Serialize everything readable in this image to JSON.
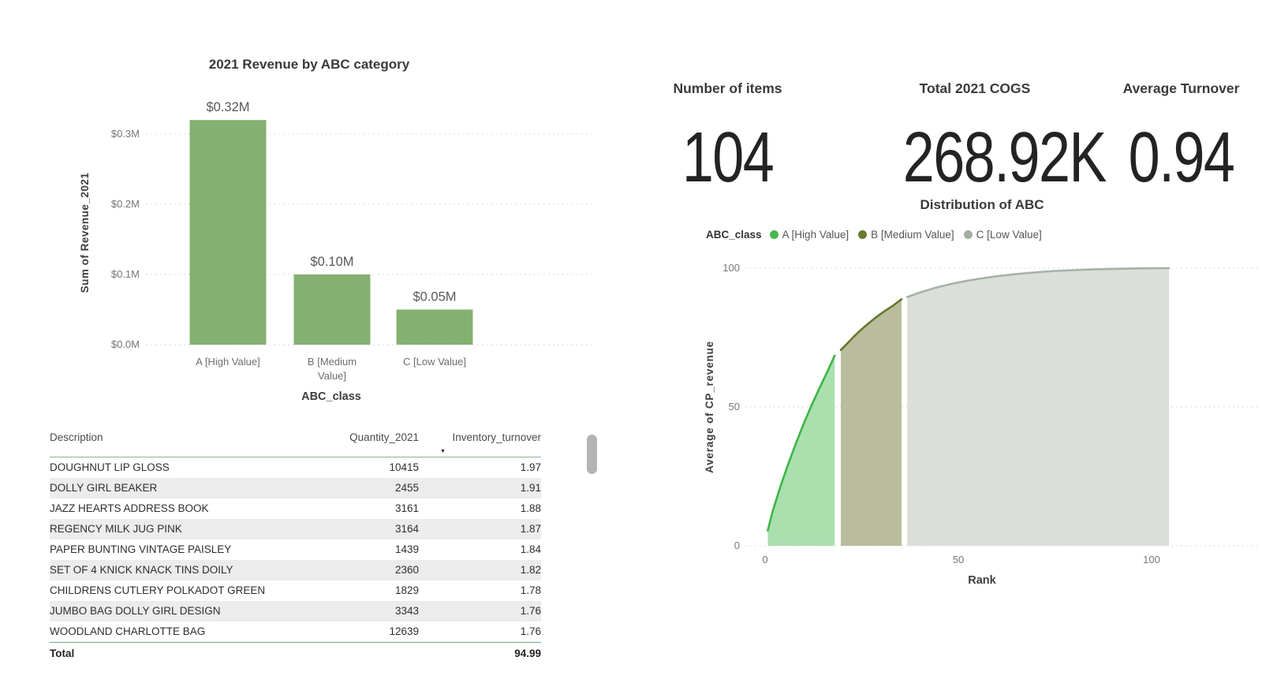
{
  "icons": {
    "sort_desc": "▼"
  },
  "colors": {
    "bar_green": "#85b06f",
    "grid": "#d6d6d6",
    "axis_text": "#767676",
    "axis_title_text": "#3d3d3d",
    "value_label_text": "#595959",
    "table_rule": "#8db395",
    "scrollbar": "#b4b4b4"
  },
  "kpi_cards": [
    {
      "label": "Number of items",
      "value": "104"
    },
    {
      "label": "Total 2021 COGS",
      "value": "268.92K"
    },
    {
      "label": "Average Turnover",
      "value": "0.94"
    }
  ],
  "chart_data": [
    {
      "type": "bar",
      "title": "2021 Revenue by ABC category",
      "xlabel": "ABC_class",
      "ylabel": "Sum of Revenue_2021",
      "categories": [
        "A [High Value]",
        "B [Medium Value]",
        "C [Low Value]"
      ],
      "category_lines": [
        [
          "A [High Value]"
        ],
        [
          "B [Medium",
          "Value]"
        ],
        [
          "C [Low Value]"
        ]
      ],
      "values": [
        0.32,
        0.1,
        0.05
      ],
      "value_labels": [
        "$0.32M",
        "$0.10M",
        "$0.05M"
      ],
      "yticks": [
        0,
        0.1,
        0.2,
        0.3
      ],
      "ytick_labels": [
        "$0.0M",
        "$0.1M",
        "$0.2M",
        "$0.3M"
      ],
      "ylim": [
        0,
        0.355
      ],
      "unit": "millions USD",
      "bar_color": "#85b06f",
      "grid": true,
      "legend": false
    },
    {
      "type": "area",
      "title": "Distribution of ABC",
      "xlabel": "Rank",
      "ylabel": "Average of CP_revenue",
      "legend_title": "ABC_class",
      "legend_position": "top",
      "xlim": [
        0,
        104
      ],
      "ylim": [
        0,
        100
      ],
      "xticks": [
        0,
        50,
        100
      ],
      "yticks": [
        0,
        50,
        100
      ],
      "grid": true,
      "series": [
        {
          "name": "A [High Value]",
          "key": "a",
          "line_color": "#3eb448",
          "fill_color": "#a9e0ae",
          "dot_color": "#47b950",
          "points": [
            [
              0.7,
              5.5
            ],
            [
              2,
              12.6
            ],
            [
              4,
              21.5
            ],
            [
              6,
              29.5
            ],
            [
              8,
              37
            ],
            [
              10,
              44
            ],
            [
              12,
              50.5
            ],
            [
              14,
              56.6
            ],
            [
              16,
              62.4
            ],
            [
              18,
              68.5
            ]
          ]
        },
        {
          "name": "B [Medium Value]",
          "key": "b",
          "line_color": "#65792c",
          "fill_color": "#b9bd9e",
          "dot_color": "#6b7b33",
          "points": [
            [
              19.6,
              70.5
            ],
            [
              21,
              72.5
            ],
            [
              23,
              75.4
            ],
            [
              25,
              78
            ],
            [
              27,
              80.4
            ],
            [
              29,
              82.6
            ],
            [
              31,
              84.6
            ],
            [
              33,
              86.4
            ],
            [
              35.3,
              88.8
            ]
          ]
        },
        {
          "name": "C [Low Value]",
          "key": "c",
          "line_color": "#a6b1a7",
          "fill_color": "#dcdfd9",
          "dot_color": "#a4afa1",
          "points": [
            [
              36.8,
              89.6
            ],
            [
              40,
              91.2
            ],
            [
              44,
              92.9
            ],
            [
              48,
              94.3
            ],
            [
              52,
              95.4
            ],
            [
              56,
              96.3
            ],
            [
              60,
              97.1
            ],
            [
              65,
              97.9
            ],
            [
              70,
              98.5
            ],
            [
              75,
              99
            ],
            [
              80,
              99.3
            ],
            [
              85,
              99.55
            ],
            [
              90,
              99.75
            ],
            [
              95,
              99.88
            ],
            [
              100,
              99.96
            ],
            [
              104.5,
              100
            ]
          ]
        }
      ]
    },
    {
      "type": "table",
      "headers": [
        "Description",
        "Quantity_2021",
        "Inventory_turnover"
      ],
      "sorted_by": "Inventory_turnover",
      "sort_order": "descending",
      "rows": [
        [
          "DOUGHNUT LIP GLOSS",
          10415,
          1.97
        ],
        [
          "DOLLY GIRL BEAKER",
          2455,
          1.91
        ],
        [
          "JAZZ HEARTS ADDRESS BOOK",
          3161,
          1.88
        ],
        [
          "REGENCY MILK JUG PINK",
          3164,
          1.87
        ],
        [
          "PAPER BUNTING VINTAGE PAISLEY",
          1439,
          1.84
        ],
        [
          "SET OF 4 KNICK KNACK TINS DOILY",
          2360,
          1.82
        ],
        [
          "CHILDRENS CUTLERY POLKADOT GREEN",
          1829,
          1.78
        ],
        [
          "JUMBO BAG DOLLY GIRL DESIGN",
          3343,
          1.76
        ],
        [
          "WOODLAND CHARLOTTE BAG",
          12639,
          1.76
        ]
      ],
      "total_label": "Total",
      "total_value": 94.99
    }
  ]
}
